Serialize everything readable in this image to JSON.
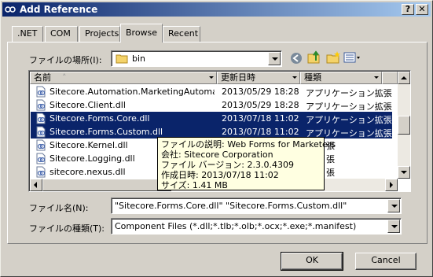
{
  "window": {
    "title": "Add Reference"
  },
  "titlebar_buttons": {
    "help": "?",
    "close": "✕"
  },
  "tabs": [
    {
      "label": ".NET",
      "active": false
    },
    {
      "label": "COM",
      "active": false
    },
    {
      "label": "Projects",
      "active": false
    },
    {
      "label": "Browse",
      "active": true
    },
    {
      "label": "Recent",
      "active": false
    }
  ],
  "lookin": {
    "label": "ファイルの場所(I):",
    "value": "bin",
    "folder_icon": "folder-icon"
  },
  "toolbar": {
    "back_icon": "back-icon",
    "up_icon": "up-folder-icon",
    "newfolder_icon": "new-folder-icon",
    "views_icon": "view-menu-icon"
  },
  "list": {
    "columns": {
      "name": "名前",
      "date": "更新日時",
      "type": "種類"
    },
    "rows": [
      {
        "name": "Sitecore.Automation.MarketingAutomati...",
        "date": "2013/05/29 18:28",
        "type": "アプリケーション拡張",
        "selected": false
      },
      {
        "name": "Sitecore.Client.dll",
        "date": "2013/05/29 18:28",
        "type": "アプリケーション拡張",
        "selected": false
      },
      {
        "name": "Sitecore.Forms.Core.dll",
        "date": "2013/07/18 11:02",
        "type": "アプリケーション拡張",
        "selected": true
      },
      {
        "name": "Sitecore.Forms.Custom.dll",
        "date": "2013/07/18 11:02",
        "type": "アプリケーション拡張",
        "selected": true
      },
      {
        "name": "Sitecore.Kernel.dll",
        "date": "",
        "type": "",
        "selected": false
      },
      {
        "name": "Sitecore.Logging.dll",
        "date": "",
        "type": "",
        "selected": false
      },
      {
        "name": "sitecore.nexus.dll",
        "date": "",
        "type": "",
        "selected": false
      }
    ],
    "tooltip": [
      "ファイルの説明: Web Forms for Marketers",
      "会社: Sitecore Corporation",
      "ファイル バージョン: 2.3.0.4309",
      "作成日時: 2013/07/18 11:02",
      "サイズ: 1.41 MB"
    ],
    "peek_types": [
      "張",
      "張",
      "張"
    ]
  },
  "filename": {
    "label": "ファイル名(N):",
    "value": "\"Sitecore.Forms.Core.dll\" \"Sitecore.Forms.Custom.dll\""
  },
  "filetype": {
    "label": "ファイルの種類(T):",
    "value": "Component Files (*.dll;*.tlb;*.olb;*.ocx;*.exe;*.manifest)"
  },
  "buttons": {
    "ok": "OK",
    "cancel": "Cancel"
  },
  "colors": {
    "selection": "#0a246a",
    "face": "#d4d0c8",
    "tooltip": "#ffffe1"
  }
}
